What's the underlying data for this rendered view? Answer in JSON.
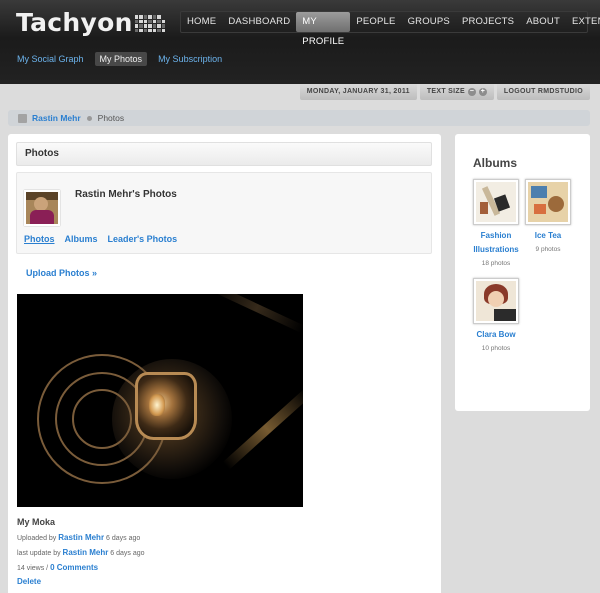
{
  "app": {
    "brand": "Tachyon",
    "colors": {
      "accent": "#2a7fd0",
      "header": "#1f1f1f",
      "subnav_link": "#6cb3ec"
    }
  },
  "nav": {
    "items": [
      {
        "label": "HOME"
      },
      {
        "label": "DASHBOARD"
      },
      {
        "label": "MY PROFILE",
        "active": true
      },
      {
        "label": "PEOPLE"
      },
      {
        "label": "GROUPS"
      },
      {
        "label": "PROJECTS"
      },
      {
        "label": "ABOUT"
      },
      {
        "label": "EXTEND"
      }
    ]
  },
  "subnav": {
    "items": [
      {
        "label": "My Social Graph"
      },
      {
        "label": "My Photos",
        "active": true
      },
      {
        "label": "My Subscription"
      }
    ]
  },
  "utility": {
    "date": "MONDAY, JANUARY 31, 2011",
    "text_size": "TEXT SIZE",
    "decrease": "−",
    "increase": "+",
    "logout": "LOGOUT RMDSTUDIO"
  },
  "breadcrumb": {
    "home_icon": "home-icon",
    "parent": "Rastin Mehr",
    "current": "Photos"
  },
  "main": {
    "section_title": "Photos",
    "profile_name": "Rastin Mehr's Photos",
    "tabs": [
      "Photos",
      "Albums",
      "Leader's Photos"
    ],
    "upload": "Upload Photos »",
    "photo": {
      "title": "My Moka",
      "uploaded_by_label": "Uploaded by",
      "uploader": "Rastin Mehr",
      "uploaded_when": "6 days ago",
      "update_label": "last update by",
      "updater": "Rastin Mehr",
      "updated_when": "6 days ago",
      "views": "14 views /",
      "comments": "0 Comments",
      "delete": "Delete"
    }
  },
  "sidebar": {
    "title": "Albums",
    "albums": [
      {
        "name": "Fashion Illustrations",
        "count": "18 photos"
      },
      {
        "name": "Ice Tea",
        "count": "9 photos"
      },
      {
        "name": "Clara Bow",
        "count": "10 photos"
      }
    ]
  }
}
